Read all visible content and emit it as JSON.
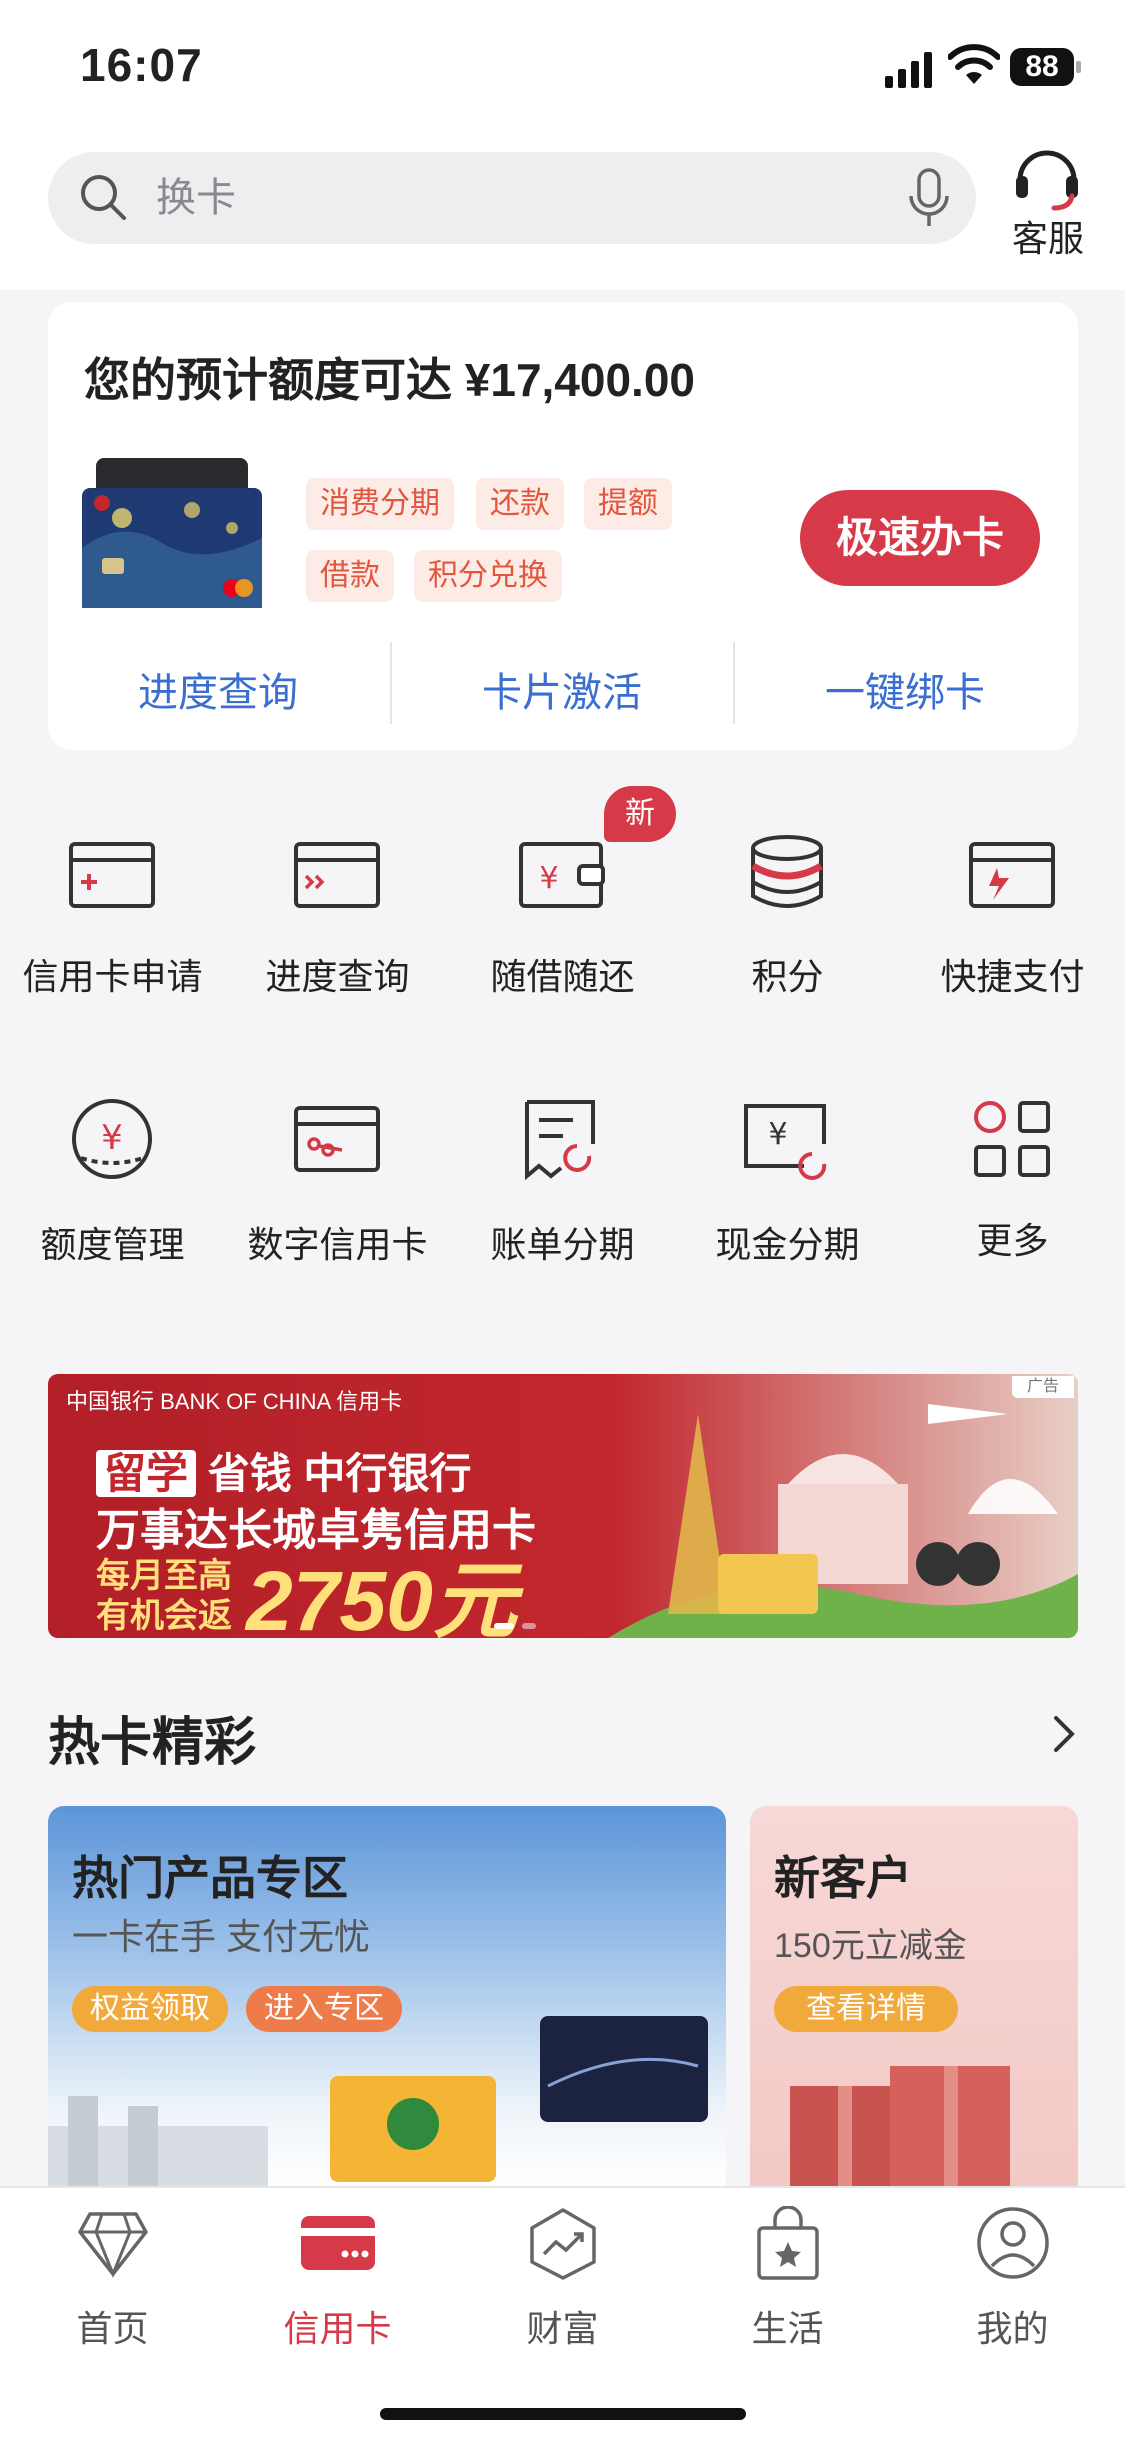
{
  "status_bar": {
    "time": "16:07",
    "battery": "88"
  },
  "search": {
    "placeholder": "换卡"
  },
  "customer_service": {
    "label": "客服"
  },
  "credit_panel": {
    "limit_text": "您的预计额度可达 ¥17,400.00",
    "tags": [
      "消费分期",
      "还款",
      "提额",
      "借款",
      "积分兑换"
    ],
    "apply_button": "极速办卡",
    "links": [
      "进度查询",
      "卡片激活",
      "一键绑卡"
    ]
  },
  "grid": {
    "row1": [
      {
        "label": "信用卡申请",
        "icon": "card-plus-icon"
      },
      {
        "label": "进度查询",
        "icon": "card-progress-icon"
      },
      {
        "label": "随借随还",
        "icon": "wallet-yuan-icon",
        "badge": "新"
      },
      {
        "label": "积分",
        "icon": "coins-stack-icon"
      },
      {
        "label": "快捷支付",
        "icon": "card-lightning-icon"
      }
    ],
    "row2": [
      {
        "label": "额度管理",
        "icon": "yuan-circle-icon"
      },
      {
        "label": "数字信用卡",
        "icon": "digital-card-icon"
      },
      {
        "label": "账单分期",
        "icon": "bill-installment-icon"
      },
      {
        "label": "现金分期",
        "icon": "cash-installment-icon"
      },
      {
        "label": "更多",
        "icon": "more-grid-icon"
      }
    ]
  },
  "banner": {
    "ad_tag": "广告",
    "bank_logo": "中国银行 BANK OF CHINA 信用卡",
    "line1_highlight": "留学",
    "line1_rest": "省钱 中行银行",
    "line2": "万事达长城卓隽信用卡",
    "line3a": "每月至高",
    "line3b": "有机会返",
    "amount": "2750元"
  },
  "hot_cards": {
    "title": "热卡精彩",
    "left": {
      "title": "热门产品专区",
      "subtitle": "一卡在手 支付无忧",
      "btn1": "权益领取",
      "btn2": "进入专区"
    },
    "right": {
      "title": "新客户",
      "subtitle": "150元立减金",
      "btn": "查看详情"
    }
  },
  "tabbar": {
    "items": [
      {
        "label": "首页",
        "icon": "diamond-icon"
      },
      {
        "label": "信用卡",
        "icon": "credit-card-icon"
      },
      {
        "label": "财富",
        "icon": "chart-up-icon"
      },
      {
        "label": "生活",
        "icon": "shopping-bag-icon"
      },
      {
        "label": "我的",
        "icon": "person-icon"
      }
    ],
    "active": "信用卡"
  },
  "colors": {
    "brand_red": "#d63a49",
    "link_blue": "#3a6fd1",
    "tag_bg": "#fdece6",
    "tag_text": "#e2563f"
  }
}
